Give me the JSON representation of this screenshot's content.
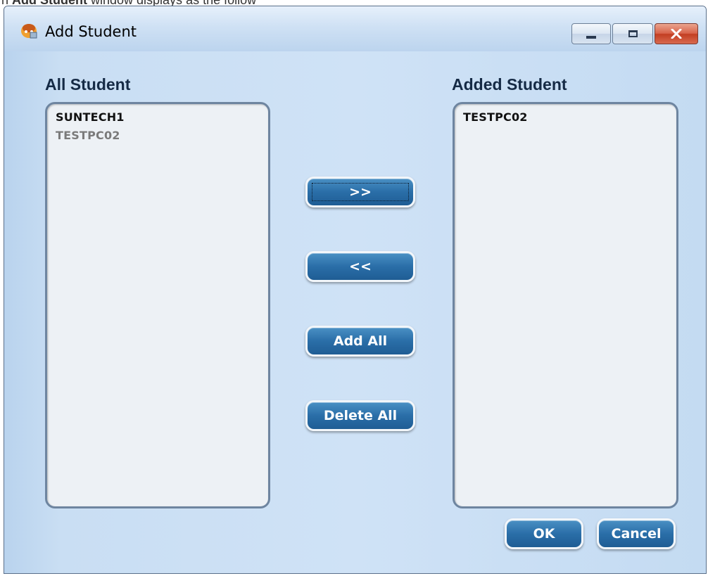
{
  "caption": {
    "prefix": "n ",
    "bold": "Add Student",
    "suffix": " window displays as the follow"
  },
  "window": {
    "title": "Add Student",
    "icon": "student-app-icon",
    "controls": [
      "minimize-icon",
      "maximize-icon",
      "close-icon"
    ]
  },
  "left_panel": {
    "title": "All Student",
    "items": [
      "SUNTECH1",
      "TESTPC02"
    ]
  },
  "right_panel": {
    "title": "Added Student",
    "items": [
      "TESTPC02"
    ]
  },
  "actions": {
    "add": ">>",
    "remove": "<<",
    "add_all": "Add All",
    "delete_all": "Delete All"
  },
  "footer": {
    "ok": "OK",
    "cancel": "Cancel"
  },
  "colors": {
    "button_blue": "#2a6ea8",
    "window_bg": "#cfe2f6",
    "close_red": "#c23e22"
  }
}
